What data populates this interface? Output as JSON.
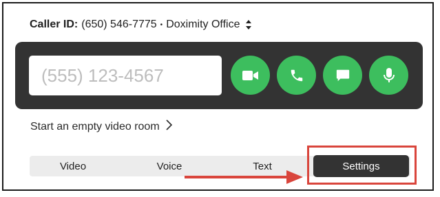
{
  "caller": {
    "label": "Caller ID:",
    "number": "(650) 546-7775",
    "separator": "•",
    "office": "Doximity Office",
    "switch_icon": "up-down-chevron-icon"
  },
  "dialer": {
    "placeholder": "(555) 123-4567",
    "actions": [
      {
        "name": "video",
        "icon": "video-camera-icon"
      },
      {
        "name": "voice",
        "icon": "phone-icon"
      },
      {
        "name": "text",
        "icon": "chat-bubble-icon"
      },
      {
        "name": "dictate",
        "icon": "microphone-icon"
      }
    ],
    "accent_color": "#3dbe5e",
    "panel_color": "#333333"
  },
  "empty_room": {
    "label": "Start an empty video room",
    "icon": "chevron-right-icon"
  },
  "tabs": [
    {
      "label": "Video",
      "active": false
    },
    {
      "label": "Voice",
      "active": false
    },
    {
      "label": "Text",
      "active": false
    },
    {
      "label": "Settings",
      "active": true
    }
  ],
  "annotation": {
    "color": "#d9453c",
    "target": "Settings"
  }
}
